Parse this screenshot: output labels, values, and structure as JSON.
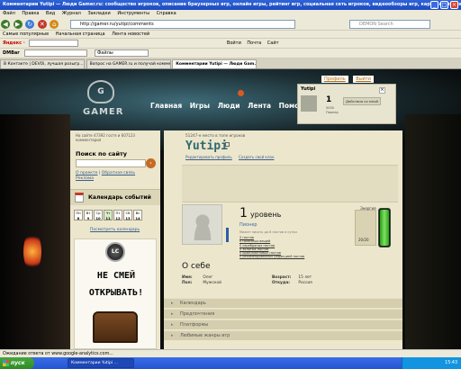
{
  "window": {
    "title": "Комментарии Yutipi — Люди Gamer.ru: сообщество игроков, описание браузерных игр, онлайн игры, рейтинг игр, социальная сеть игроков, видеообзоры игр, карточка игрока - Mozilla Firefox"
  },
  "menu": [
    "Файл",
    "Правка",
    "Вид",
    "Журнал",
    "Закладки",
    "Инструменты",
    "Справка"
  ],
  "nav": {
    "url": "http://gamer.ru/yutipi/comments",
    "search_placeholder": "DEMON Search"
  },
  "bookmarks": [
    "Самые популярные",
    "Начальная страница",
    "Лента новостей"
  ],
  "yandex": {
    "label": "Яндекс ·",
    "items": [
      "Войти",
      "Почта",
      "Сайт"
    ]
  },
  "dmbar": {
    "label": "DMBar",
    "field": "Файлы"
  },
  "tabs": [
    {
      "label": "В Контакте | DEVOi, лучшая розыгр..."
    },
    {
      "label": "Вопрос на GAMER.ru и получай комме..."
    },
    {
      "label": "Комментарии Yutipi — Люди Gam..."
    }
  ],
  "header": {
    "logo_emblem": "G",
    "logo_text": "GAMER",
    "nav": [
      "Главная",
      "Игры",
      "Люди",
      "Лента",
      "Помощь"
    ]
  },
  "profile_box": {
    "name": "Yutipi",
    "links": [
      "Профиль",
      "Выйти"
    ],
    "level": "1",
    "sub1": "5000",
    "sub2": "Пионер",
    "button": "Действия со мной"
  },
  "sidebar": {
    "count_text": "На сайте 47392 гостя и 607123 комментария",
    "search_title": "Поиск по сайту",
    "search_links": [
      "О проекте",
      "Обратная связь",
      "Реклама"
    ],
    "calendar_title": "Календарь событий",
    "days": [
      {
        "name": "Пн",
        "num": "8"
      },
      {
        "name": "Вт",
        "num": "9"
      },
      {
        "name": "Ср",
        "num": "10"
      },
      {
        "name": "Чт",
        "num": "11"
      },
      {
        "name": "Пт",
        "num": "12"
      },
      {
        "name": "Сб",
        "num": "13"
      },
      {
        "name": "Вс",
        "num": "14"
      }
    ],
    "today_index": 3,
    "calendar_link": "Посмотреть календарь",
    "ad_logo": "LC",
    "ad_line1": "НЕ СМЕЙ",
    "ad_line2": "ОТКРЫВАТЬ!"
  },
  "profile": {
    "rank_text": "51247-е место в топе игроков",
    "name": "Yutipi",
    "links": [
      "Редактировать профиль",
      "Создать свой клан"
    ],
    "level_num": "1",
    "level_word": "уровень",
    "title": "Пионер",
    "note": "Может писать до 8 постов в сутки",
    "achievements": [
      "0 постов",
      "0 полезных вещей",
      "0 серебряных постов",
      "0 золотых постов",
      "0 бриллиантовых постов",
      "0 рекомендованных редакцией постов"
    ],
    "energy_label": "Энергия",
    "energy_value": "20/20",
    "energy_fraction": 1.0,
    "about_title": "О себе",
    "name_label": "Имя:",
    "name_value": "Олег",
    "gender_label": "Пол:",
    "gender_value": "Мужской",
    "age_label": "Возраст:",
    "age_value": "15 лет",
    "from_label": "Откуда:",
    "from_value": "Россия",
    "sections": [
      "Календарь",
      "Предпочтения",
      "Платформы",
      "Любимые жанры игр"
    ]
  },
  "status": {
    "text": "Ожидание ответа от www.google-analytics.com..."
  },
  "taskbar": {
    "start": "пуск",
    "item": "Комментарии Yutipi ...",
    "clock": "15:43"
  }
}
